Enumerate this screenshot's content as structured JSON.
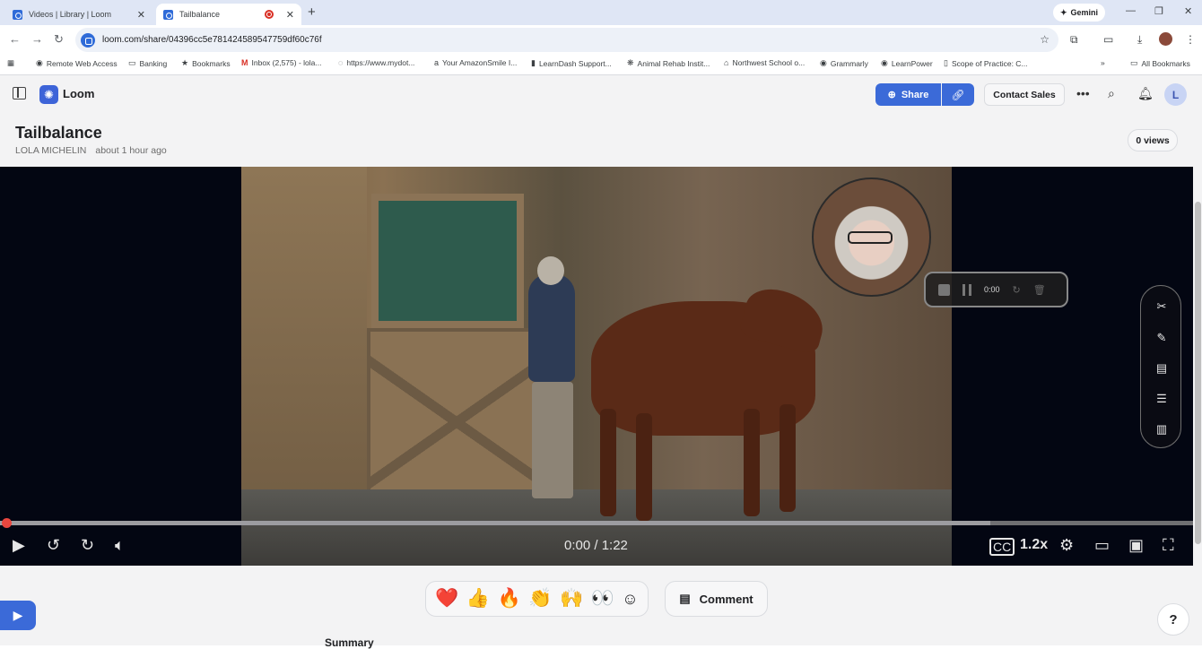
{
  "browser": {
    "tabs": [
      {
        "title": "Videos | Library | Loom",
        "active": false
      },
      {
        "title": "Tailbalance",
        "active": true
      }
    ],
    "gemini_label": "Gemini",
    "url": "loom.com/share/04396cc5e781424589547759df60c76f",
    "bookmarks": [
      {
        "label": "Remote Web Access",
        "icon": "globe-icon"
      },
      {
        "label": "Banking",
        "icon": "folder-icon"
      },
      {
        "label": "Bookmarks",
        "icon": "star-icon"
      },
      {
        "label": "Inbox (2,575) - lola...",
        "icon": "gmail-icon"
      },
      {
        "label": "https://www.mydot...",
        "icon": "page-icon"
      },
      {
        "label": "Your AmazonSmile I...",
        "icon": "amazon-icon"
      },
      {
        "label": "LearnDash Support...",
        "icon": "chart-icon"
      },
      {
        "label": "Animal Rehab Instit...",
        "icon": "paw-icon"
      },
      {
        "label": "Northwest School o...",
        "icon": "school-icon"
      },
      {
        "label": "Grammarly",
        "icon": "globe-icon"
      },
      {
        "label": "LearnPower",
        "icon": "globe-icon"
      },
      {
        "label": "Scope of Practice: C...",
        "icon": "page-icon"
      }
    ],
    "all_bookmarks": "All Bookmarks"
  },
  "header": {
    "brand": "Loom",
    "share_label": "Share",
    "contact_sales_label": "Contact Sales",
    "avatar_initial": "L"
  },
  "video_info": {
    "title": "Tailbalance",
    "author": "LOLA MICHELIN",
    "time_ago": "about 1 hour ago",
    "views": "0 views"
  },
  "player": {
    "timecode": "0:00 / 1:22",
    "speed": "1.2x",
    "recording_timer": "0:00",
    "progress": 0.0,
    "buffered": 0.83
  },
  "reactions": [
    "❤️",
    "👍",
    "🔥",
    "👏",
    "🙌",
    "👀"
  ],
  "comment_label": "Comment",
  "summary_label": "Summary",
  "help_label": "?",
  "colors": {
    "accent": "#3b6ad8",
    "progress_knob": "#e9473f",
    "page_bg": "#f3f3f4",
    "video_bg": "#030612"
  }
}
